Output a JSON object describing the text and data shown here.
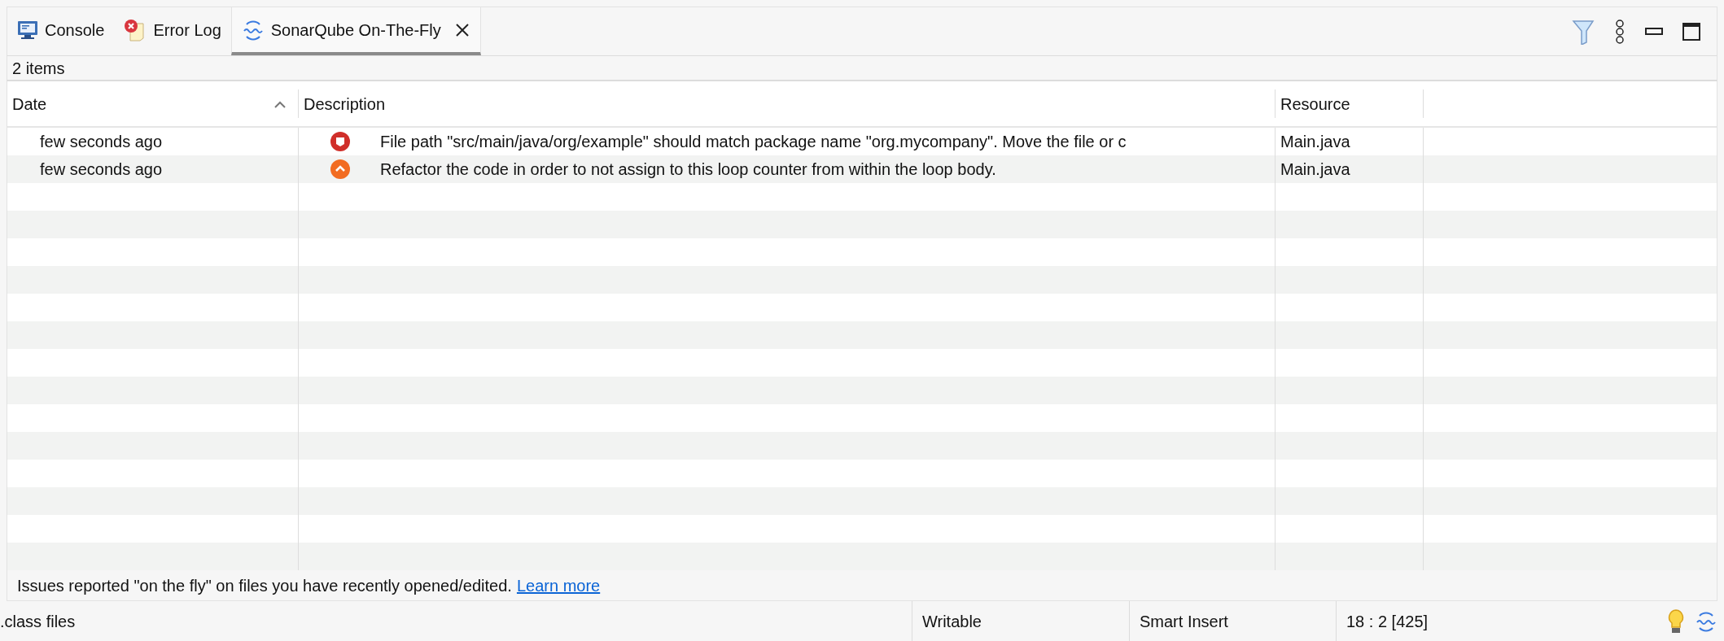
{
  "tabs": [
    {
      "label": "Console",
      "kind": "console",
      "selected": false,
      "closable": false
    },
    {
      "label": "Error Log",
      "kind": "errorlog",
      "selected": false,
      "closable": false
    },
    {
      "label": "SonarQube On-The-Fly",
      "kind": "sonar",
      "selected": true,
      "closable": true
    }
  ],
  "item_count": "2 items",
  "table": {
    "columns": [
      {
        "label": "Date",
        "sorted": true
      },
      {
        "label": "Description",
        "sorted": false
      },
      {
        "label": "Resource",
        "sorted": false
      }
    ],
    "rows": [
      {
        "date": "few seconds ago",
        "kind": "blocker",
        "description": "File path \"src/main/java/org/example\" should match package name \"org.mycompany\". Move the file or c",
        "resource": "Main.java"
      },
      {
        "date": "few seconds ago",
        "kind": "critical",
        "description": "Refactor the code in order to not assign to this loop counter from within the loop body.",
        "resource": "Main.java"
      }
    ]
  },
  "footer": {
    "text": "Issues reported \"on the fly\" on files you have recently opened/edited.",
    "link": "Learn more"
  },
  "status_bar": [
    ".class files",
    "Writable",
    "Smart Insert",
    "18 : 2 [425]"
  ]
}
